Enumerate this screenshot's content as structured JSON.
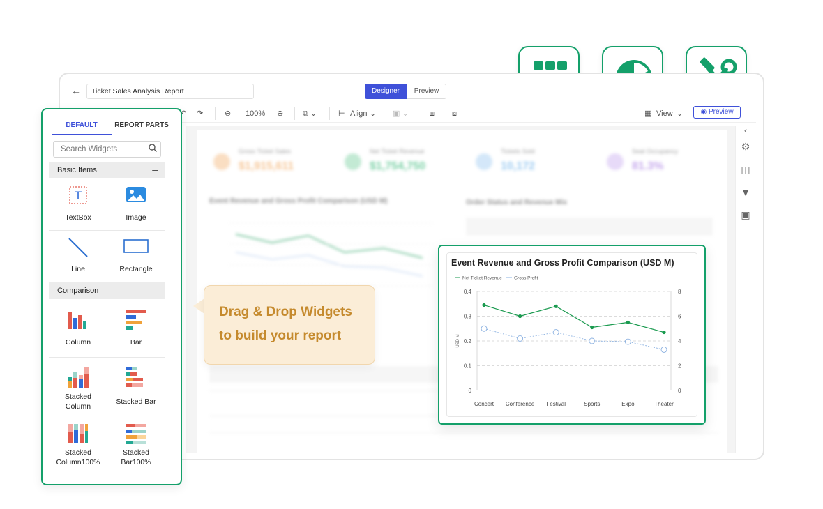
{
  "app": {
    "report_name": "Ticket Sales Analysis Report",
    "designer_label": "Designer",
    "preview_toggle_label": "Preview",
    "zoom": "100%",
    "align_label": "Align",
    "view_label": "View",
    "preview_button_label": "Preview"
  },
  "panel": {
    "tabs": [
      "DEFAULT",
      "REPORT PARTS"
    ],
    "search_placeholder": "Search Widgets",
    "sections": [
      {
        "title": "Basic Items"
      },
      {
        "title": "Comparison"
      }
    ],
    "basic_items": [
      {
        "label": "TextBox",
        "icon": "textbox-icon"
      },
      {
        "label": "Image",
        "icon": "image-icon"
      },
      {
        "label": "Line",
        "icon": "line-icon"
      },
      {
        "label": "Rectangle",
        "icon": "rectangle-icon"
      }
    ],
    "comparison_items": [
      {
        "label": "Column",
        "icon": "column-chart-icon"
      },
      {
        "label": "Bar",
        "icon": "bar-chart-icon"
      },
      {
        "label": "Stacked Column",
        "line1": "Stacked",
        "line2": "Column",
        "icon": "stacked-column-icon"
      },
      {
        "label": "Stacked Bar",
        "icon": "stacked-bar-icon"
      },
      {
        "label": "Stacked Column100%",
        "line1": "Stacked",
        "line2": "Column100%",
        "icon": "stacked-column100-icon"
      },
      {
        "label": "Stacked Bar100%",
        "line1": "Stacked",
        "line2": "Bar100%",
        "icon": "stacked-bar100-icon"
      }
    ]
  },
  "callout": {
    "line1": "Drag & Drop Widgets",
    "line2": "to build your report"
  },
  "features": [
    {
      "icon": "grid-table-icon"
    },
    {
      "icon": "pie-chart-icon"
    },
    {
      "icon": "tools-icon"
    }
  ],
  "colors": {
    "accent_green": "#14a06a",
    "accent_blue": "#3f51d9",
    "callout_text": "#c58a2d",
    "callout_bg": "#fbedd7",
    "series_net": "#1a9a4f",
    "series_gross": "#8ab0e0"
  },
  "background_report": {
    "kpis": [
      {
        "label": "Gross Ticket Sales",
        "value": "$1,915,611",
        "color": "#f0a050"
      },
      {
        "label": "Net Ticket Revenue",
        "value": "$1,754,750",
        "color": "#22b26a"
      },
      {
        "label": "Tickets Sold",
        "value": "10,172",
        "color": "#5aa8e8"
      },
      {
        "label": "Seat Occupancy",
        "value": "81.3%",
        "color": "#a070e0"
      }
    ],
    "chart_title": "Event Revenue and Gross Profit Comparison (USD M)",
    "table_title": "Order Status and Revenue Mix"
  },
  "chart_data": {
    "type": "line",
    "title": "Event Revenue and Gross Profit Comparison (USD M)",
    "categories": [
      "Concert",
      "Conference",
      "Festival",
      "Sports",
      "Expo",
      "Theater"
    ],
    "ylabel": "USD M",
    "ylim": [
      0,
      0.4
    ],
    "y_ticks": [
      "0",
      "0.1",
      "0.2",
      "0.3",
      "0.4"
    ],
    "y2lim": [
      0,
      8
    ],
    "y2_ticks": [
      "0",
      "2",
      "4",
      "6",
      "8"
    ],
    "legend": "top-left",
    "grid": true,
    "series": [
      {
        "name": "Net Ticket Revenue",
        "axis": "left",
        "values": [
          0.345,
          0.3,
          0.34,
          0.255,
          0.275,
          0.235
        ],
        "color": "#1a9a4f"
      },
      {
        "name": "Gross Profit",
        "axis": "left",
        "values": [
          0.25,
          0.21,
          0.235,
          0.2,
          0.197,
          0.165
        ],
        "color": "#8ab0e0"
      }
    ]
  }
}
